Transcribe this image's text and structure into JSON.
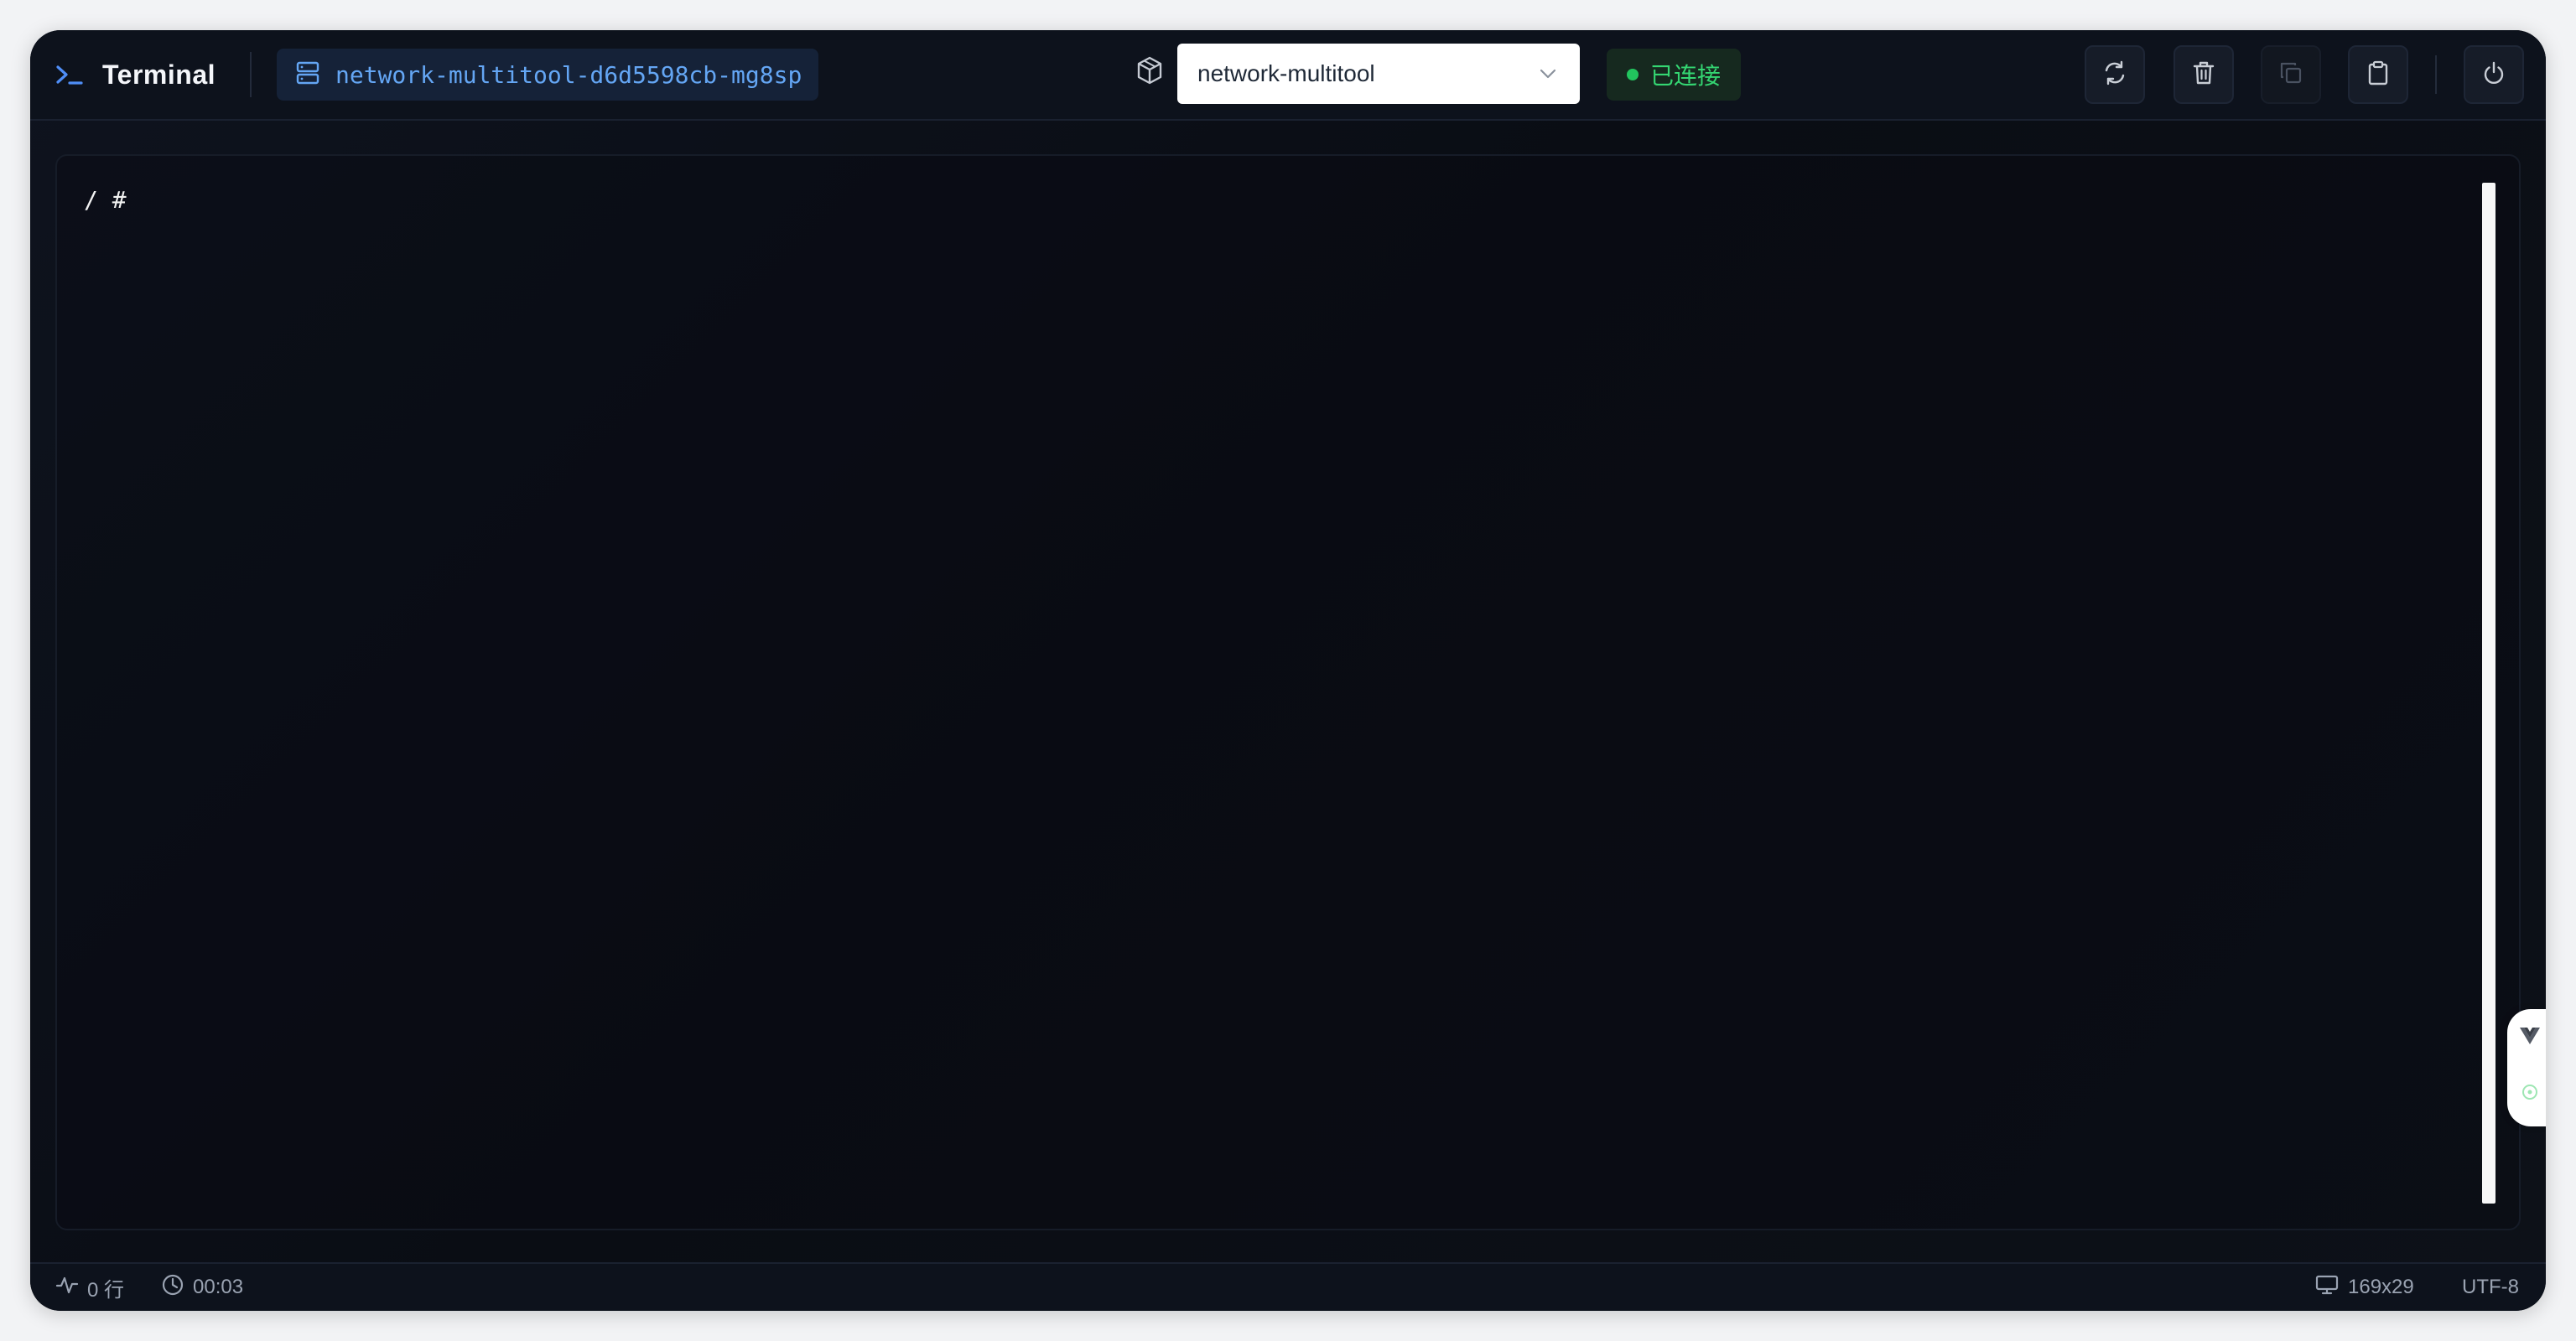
{
  "header": {
    "title": "Terminal",
    "pod_name": "network-multitool-d6d5598cb-mg8sp",
    "container": {
      "selected": "network-multitool"
    },
    "status": {
      "label": "已连接",
      "color": "#22c55e"
    },
    "toolbar": [
      {
        "icon": "refresh-icon",
        "enabled": true
      },
      {
        "icon": "trash-icon",
        "enabled": true
      },
      {
        "icon": "copy-icon",
        "enabled": false
      },
      {
        "icon": "clipboard-icon",
        "enabled": true
      },
      {
        "icon": "power-icon",
        "enabled": true
      }
    ]
  },
  "terminal": {
    "content": "/ #"
  },
  "footer": {
    "lines": "0 行",
    "elapsed": "00:03",
    "size": "169x29",
    "encoding": "UTF-8"
  },
  "colors": {
    "accent": "#4f8ef7",
    "pod_text": "#64a6f4",
    "background": "#0a0d14"
  }
}
